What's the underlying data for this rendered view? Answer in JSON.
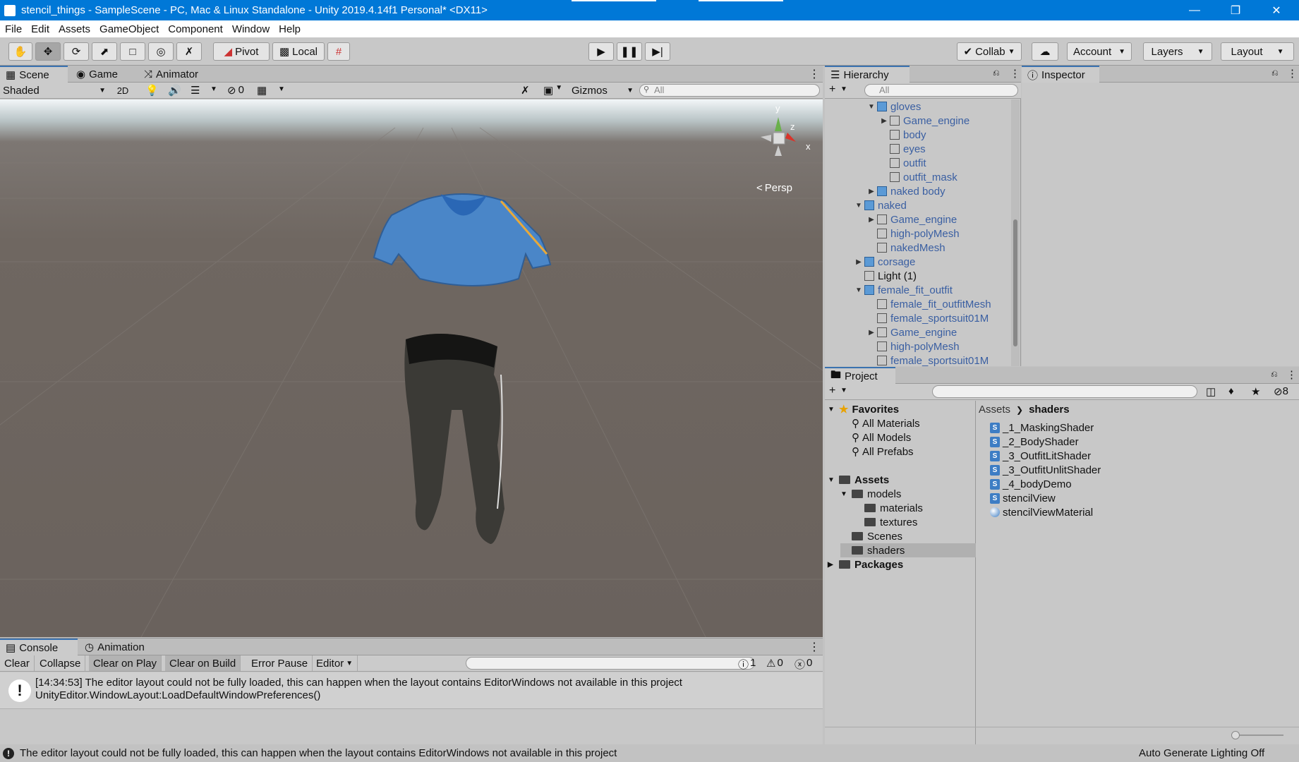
{
  "window": {
    "title": "stencil_things - SampleScene - PC, Mac & Linux Standalone - Unity 2019.4.14f1 Personal* <DX11>"
  },
  "menu": [
    "File",
    "Edit",
    "Assets",
    "GameObject",
    "Component",
    "Window",
    "Help"
  ],
  "toolbar": {
    "pivot": "Pivot",
    "local": "Local",
    "collab": "Collab",
    "account": "Account",
    "layers": "Layers",
    "layout": "Layout"
  },
  "scene_panel": {
    "tabs": [
      "Scene",
      "Game",
      "Animator"
    ],
    "shading": "Shaded",
    "mode_2d": "2D",
    "hidden_count": "0",
    "gizmos": "Gizmos",
    "search_placeholder": "All",
    "persp": "Persp",
    "axis_x": "x",
    "axis_y": "y",
    "axis_z": "z"
  },
  "hierarchy": {
    "title": "Hierarchy",
    "search_placeholder": "All",
    "items": [
      {
        "label": "gloves",
        "indent": 2,
        "arrow": "down",
        "icon": "prefab"
      },
      {
        "label": "Game_engine",
        "indent": 3,
        "arrow": "right",
        "icon": "prefab-outline"
      },
      {
        "label": "body",
        "indent": 3,
        "arrow": "",
        "icon": "prefab-outline"
      },
      {
        "label": "eyes",
        "indent": 3,
        "arrow": "",
        "icon": "prefab-outline"
      },
      {
        "label": "outfit",
        "indent": 3,
        "arrow": "",
        "icon": "prefab-outline"
      },
      {
        "label": "outfit_mask",
        "indent": 3,
        "arrow": "",
        "icon": "prefab-outline"
      },
      {
        "label": "naked body",
        "indent": 2,
        "arrow": "right",
        "icon": "prefab"
      },
      {
        "label": "naked",
        "indent": 1,
        "arrow": "down",
        "icon": "prefab"
      },
      {
        "label": "Game_engine",
        "indent": 2,
        "arrow": "right",
        "icon": "prefab-outline"
      },
      {
        "label": "high-polyMesh",
        "indent": 2,
        "arrow": "",
        "icon": "prefab-outline"
      },
      {
        "label": "nakedMesh",
        "indent": 2,
        "arrow": "",
        "icon": "prefab-outline"
      },
      {
        "label": "corsage",
        "indent": 1,
        "arrow": "right",
        "icon": "prefab"
      },
      {
        "label": "Light (1)",
        "indent": 1,
        "arrow": "",
        "icon": "gameobject"
      },
      {
        "label": "female_fit_outfit",
        "indent": 1,
        "arrow": "down",
        "icon": "prefab"
      },
      {
        "label": "female_fit_outfitMesh",
        "indent": 2,
        "arrow": "",
        "icon": "prefab-outline"
      },
      {
        "label": "female_sportsuit01M",
        "indent": 2,
        "arrow": "",
        "icon": "prefab-outline"
      },
      {
        "label": "Game_engine",
        "indent": 2,
        "arrow": "right",
        "icon": "prefab-outline"
      },
      {
        "label": "high-polyMesh",
        "indent": 2,
        "arrow": "",
        "icon": "prefab-outline"
      },
      {
        "label": "female_sportsuit01M",
        "indent": 2,
        "arrow": "",
        "icon": "prefab-outline"
      }
    ]
  },
  "inspector": {
    "title": "Inspector"
  },
  "project": {
    "title": "Project",
    "hidden_count": "8",
    "breadcrumb": [
      "Assets",
      "shaders"
    ],
    "favorites": {
      "label": "Favorites",
      "items": [
        "All Materials",
        "All Models",
        "All Prefabs"
      ]
    },
    "tree": [
      {
        "label": "Assets",
        "indent": 0,
        "arrow": "down",
        "bold": true
      },
      {
        "label": "models",
        "indent": 1,
        "arrow": "down",
        "bold": false
      },
      {
        "label": "materials",
        "indent": 2,
        "arrow": "",
        "bold": false
      },
      {
        "label": "textures",
        "indent": 2,
        "arrow": "",
        "bold": false
      },
      {
        "label": "Scenes",
        "indent": 1,
        "arrow": "",
        "bold": false
      },
      {
        "label": "shaders",
        "indent": 1,
        "arrow": "",
        "bold": false,
        "selected": true
      },
      {
        "label": "Packages",
        "indent": 0,
        "arrow": "right",
        "bold": true
      }
    ],
    "files": [
      {
        "label": "_1_MaskingShader",
        "icon": "shader"
      },
      {
        "label": "_2_BodyShader",
        "icon": "shader"
      },
      {
        "label": "_3_OutfitLitShader",
        "icon": "shader"
      },
      {
        "label": "_3_OutfitUnlitShader",
        "icon": "shader"
      },
      {
        "label": "_4_bodyDemo",
        "icon": "shader"
      },
      {
        "label": "stencilView",
        "icon": "shader"
      },
      {
        "label": "stencilViewMaterial",
        "icon": "material"
      }
    ]
  },
  "console": {
    "tabs": [
      "Console",
      "Animation"
    ],
    "buttons": [
      "Clear",
      "Collapse",
      "Clear on Play",
      "Clear on Build",
      "Error Pause",
      "Editor"
    ],
    "counts": {
      "log": "1",
      "warn": "0",
      "error": "0"
    },
    "message_line1": "[14:34:53] The editor layout could not be fully loaded, this can happen when the layout contains EditorWindows not available in this project",
    "message_line2": "UnityEditor.WindowLayout:LoadDefaultWindowPreferences()"
  },
  "statusbar": {
    "message": "The editor layout could not be fully loaded, this can happen when the layout contains EditorWindows not available in this project",
    "right": "Auto Generate Lighting Off"
  },
  "colors": {
    "titlebar": "#0078d7",
    "prefab_text": "#3a5fa2",
    "shirt": "#4a86c8",
    "pants": "#3b3a36"
  }
}
